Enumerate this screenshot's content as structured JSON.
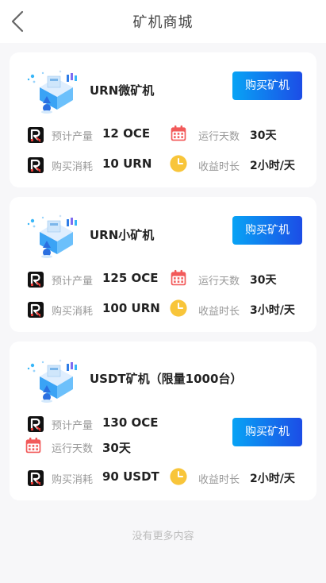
{
  "header": {
    "title": "矿机商城"
  },
  "products": [
    {
      "name": "URN微矿机",
      "buy_label": "购买矿机",
      "output_label": "预计产量",
      "output_value": "12 OCE",
      "days_label": "运行天数",
      "days_value": "30天",
      "cost_label": "购买消耗",
      "cost_value": "10 URN",
      "hours_label": "收益时长",
      "hours_value": "2小时/天"
    },
    {
      "name": "URN小矿机",
      "buy_label": "购买矿机",
      "output_label": "预计产量",
      "output_value": "125 OCE",
      "days_label": "运行天数",
      "days_value": "30天",
      "cost_label": "购买消耗",
      "cost_value": "100 URN",
      "hours_label": "收益时长",
      "hours_value": "3小时/天"
    },
    {
      "name": "USDT矿机（限量1000台）",
      "buy_label": "购买矿机",
      "output_label": "预计产量",
      "output_value": "130 OCE",
      "days_label": "运行天数",
      "days_value": "30天",
      "cost_label": "购买消耗",
      "cost_value": "90 USDT",
      "hours_label": "收益时长",
      "hours_value": "2小时/天"
    }
  ],
  "footer": {
    "note": "没有更多内容"
  },
  "icons": {
    "back": "chevron-left-icon",
    "token": "r-logo-icon",
    "calendar": "calendar-icon",
    "clock": "clock-icon",
    "product": "mining-machine-illustration"
  },
  "colors": {
    "button_gradient_start": "#08a3f5",
    "button_gradient_end": "#1c4de6",
    "calendar_red": "#f25a5a",
    "clock_yellow": "#f8c53a"
  }
}
